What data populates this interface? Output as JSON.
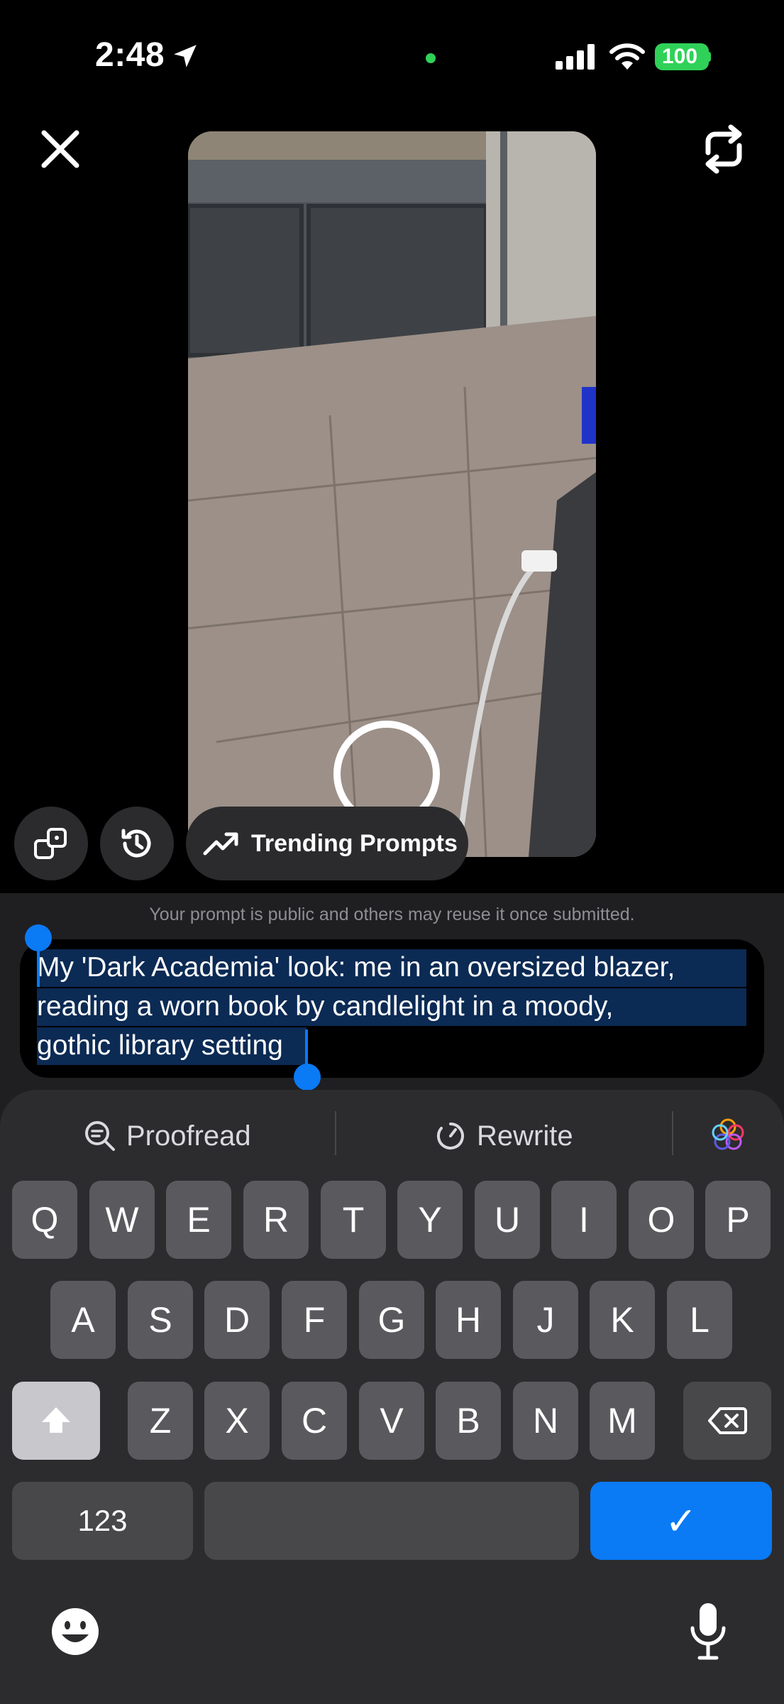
{
  "status_bar": {
    "time": "2:48",
    "battery": "100"
  },
  "action_bar": {
    "trending_label": "Trending Prompts"
  },
  "prompt": {
    "notice": "Your prompt is public and others may reuse it once submitted.",
    "lines": [
      "My 'Dark Academia' look: me in an oversized blazer,",
      "reading a worn book by candlelight in a moody,",
      "gothic library setting"
    ]
  },
  "keyboard": {
    "tools": {
      "proofread": "Proofread",
      "rewrite": "Rewrite"
    },
    "row1": [
      "Q",
      "W",
      "E",
      "R",
      "T",
      "Y",
      "U",
      "I",
      "O",
      "P"
    ],
    "row2": [
      "A",
      "S",
      "D",
      "F",
      "G",
      "H",
      "J",
      "K",
      "L"
    ],
    "row3": [
      "Z",
      "X",
      "C",
      "V",
      "B",
      "N",
      "M"
    ],
    "numbers_key": "123",
    "return_key": "✓"
  },
  "colors": {
    "accent": "#0a7af5",
    "battery": "#30d158",
    "panel": "#1f1f21",
    "keyboard": "#2c2c2e"
  }
}
